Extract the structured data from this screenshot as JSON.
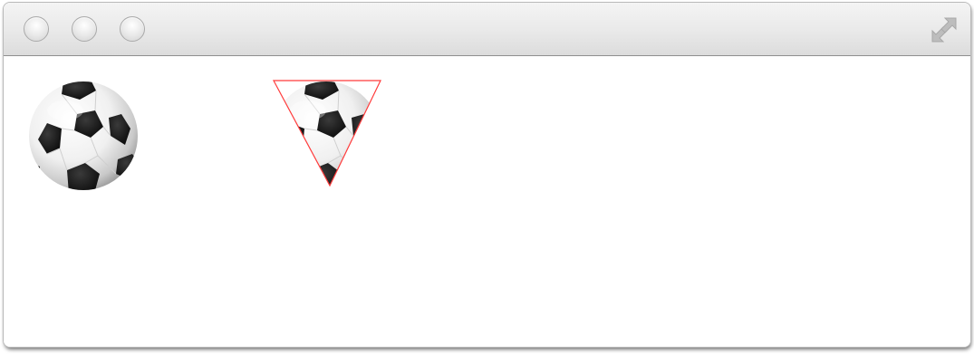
{
  "window": {
    "title": "",
    "buttons": [
      "close",
      "minimize",
      "zoom"
    ],
    "fullscreen_icon": "fullscreen-arrows-icon"
  },
  "canvas": {
    "items": [
      {
        "name": "soccer-ball",
        "shape": "circle"
      },
      {
        "name": "soccer-ball-triangle-clip",
        "shape": "triangle",
        "outline_color": "#ff3b3b"
      }
    ]
  },
  "colors": {
    "clip_outline": "#ff3b3b",
    "titlebar_top": "#f4f4f4",
    "titlebar_bottom": "#dcdcdc"
  }
}
